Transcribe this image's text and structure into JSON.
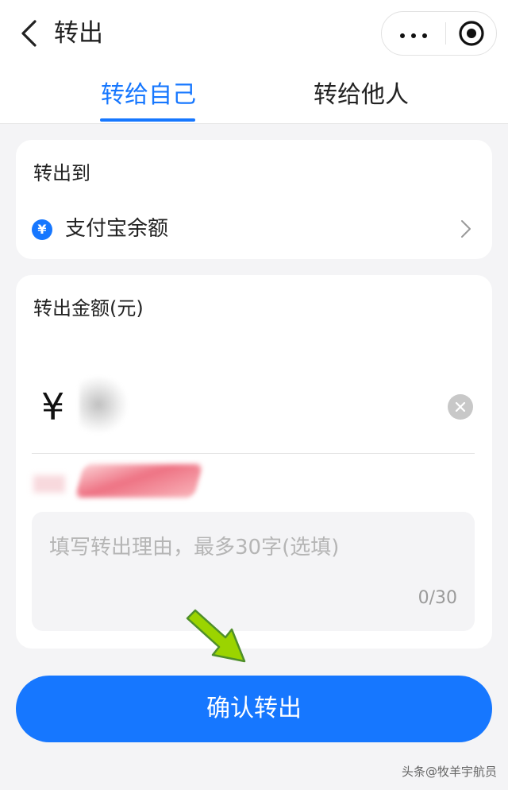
{
  "header": {
    "title": "转出"
  },
  "tabs": [
    {
      "label": "转给自己",
      "active": true
    },
    {
      "label": "转给他人",
      "active": false
    }
  ],
  "destination": {
    "section_label": "转出到",
    "account_icon": "yuan-circle-icon",
    "account_icon_glyph": "¥",
    "account_name": "支付宝余额"
  },
  "amount": {
    "section_label": "转出金额(元)",
    "currency_symbol": "¥",
    "reason_placeholder": "填写转出理由，最多30字(选填)",
    "reason_count": "0/30"
  },
  "confirm_button": {
    "label": "确认转出"
  },
  "watermark": "头条@牧羊宇航员",
  "colors": {
    "accent": "#1677ff",
    "background": "#f4f4f6",
    "arrow": "#9bd400"
  }
}
